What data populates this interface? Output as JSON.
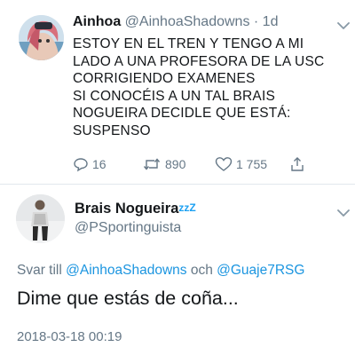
{
  "tweet": {
    "display_name": "Ainhoa",
    "handle": "@AinhoaShadowns",
    "separator": " · ",
    "age": "1d",
    "lines": [
      "ESTOY EN EL TREN Y TENGO A MI",
      "LADO A UNA PROFESORA DE LA USC",
      "CORRIGIENDO EXAMENES",
      "SI CONOCÉIS A UN TAL BRAIS",
      "NOGUEIRA DECIDLE QUE ESTÁ:",
      "SUSPENSO"
    ],
    "reply_count": "16",
    "retweet_count": "890",
    "like_count": "1 755",
    "icons": [
      "reply-icon",
      "retweet-icon",
      "heart-icon",
      "share-icon",
      "chevron-down-icon"
    ]
  },
  "reply": {
    "display_name": "Brais Nogueira",
    "name_badge": "zzZ",
    "handle": "@PSportinguista",
    "reply_prefix": "Svar till ",
    "mention_1": "@AinhoaShadowns",
    "joiner": " och ",
    "mention_2": "@Guaje7RSG",
    "text": "Dime que estás de coña...",
    "timestamp": "2018-03-18 00:19"
  },
  "colors": {
    "text": "#14171a",
    "muted": "#657786",
    "link": "#1b95e0",
    "divider": "#e1e8ed"
  }
}
